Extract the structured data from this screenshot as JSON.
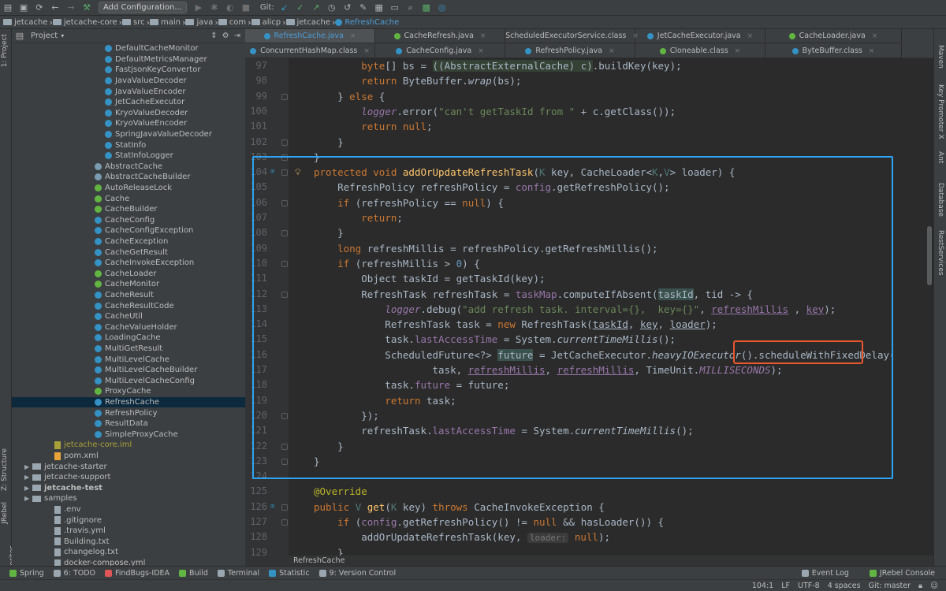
{
  "toolbar": {
    "breadcrumbs": [
      "jetcache",
      "jetcache-core",
      "src",
      "main",
      "java",
      "com",
      "alicp",
      "jetcache",
      "RefreshCache"
    ],
    "add_configuration": "Add Configuration...",
    "git_label": "Git:"
  },
  "left_stripe": {
    "project": "1: Project",
    "structure": "Z: Structure",
    "jrebel": "JRebel",
    "favorites": "2: Favorites"
  },
  "right_stripe": {
    "maven": "Maven",
    "key_promoter": "Key Promoter X",
    "ant": "Ant",
    "database": "Database",
    "rest_services": "RestServices"
  },
  "project_panel": {
    "title": "Project",
    "tree": [
      {
        "label": "DefaultCacheMonitor",
        "kind": "class",
        "indent": 1
      },
      {
        "label": "DefaultMetricsManager",
        "kind": "class",
        "indent": 1
      },
      {
        "label": "FastjsonKeyConvertor",
        "kind": "class",
        "indent": 1
      },
      {
        "label": "JavaValueDecoder",
        "kind": "class",
        "indent": 1
      },
      {
        "label": "JavaValueEncoder",
        "kind": "class",
        "indent": 1
      },
      {
        "label": "JetCacheExecutor",
        "kind": "class",
        "indent": 1
      },
      {
        "label": "KryoValueDecoder",
        "kind": "class",
        "indent": 1
      },
      {
        "label": "KryoValueEncoder",
        "kind": "class",
        "indent": 1
      },
      {
        "label": "SpringJavaValueDecoder",
        "kind": "class",
        "indent": 1
      },
      {
        "label": "StatInfo",
        "kind": "class",
        "indent": 1
      },
      {
        "label": "StatInfoLogger",
        "kind": "class",
        "indent": 1
      },
      {
        "label": "AbstractCache",
        "kind": "abstract",
        "indent": 0
      },
      {
        "label": "AbstractCacheBuilder",
        "kind": "abstract",
        "indent": 0
      },
      {
        "label": "AutoReleaseLock",
        "kind": "interface",
        "indent": 0
      },
      {
        "label": "Cache",
        "kind": "interface",
        "indent": 0
      },
      {
        "label": "CacheBuilder",
        "kind": "interface",
        "indent": 0
      },
      {
        "label": "CacheConfig",
        "kind": "class",
        "indent": 0
      },
      {
        "label": "CacheConfigException",
        "kind": "class",
        "indent": 0
      },
      {
        "label": "CacheException",
        "kind": "class",
        "indent": 0
      },
      {
        "label": "CacheGetResult",
        "kind": "class",
        "indent": 0
      },
      {
        "label": "CacheInvokeException",
        "kind": "class",
        "indent": 0
      },
      {
        "label": "CacheLoader",
        "kind": "interface",
        "indent": 0
      },
      {
        "label": "CacheMonitor",
        "kind": "interface",
        "indent": 0
      },
      {
        "label": "CacheResult",
        "kind": "class",
        "indent": 0
      },
      {
        "label": "CacheResultCode",
        "kind": "class",
        "indent": 0
      },
      {
        "label": "CacheUtil",
        "kind": "class",
        "indent": 0
      },
      {
        "label": "CacheValueHolder",
        "kind": "class",
        "indent": 0
      },
      {
        "label": "LoadingCache",
        "kind": "class",
        "indent": 0
      },
      {
        "label": "MultiGetResult",
        "kind": "class",
        "indent": 0
      },
      {
        "label": "MultiLevelCache",
        "kind": "class",
        "indent": 0
      },
      {
        "label": "MultiLevelCacheBuilder",
        "kind": "class",
        "indent": 0
      },
      {
        "label": "MultiLevelCacheConfig",
        "kind": "class",
        "indent": 0
      },
      {
        "label": "ProxyCache",
        "kind": "interface",
        "indent": 0
      },
      {
        "label": "RefreshCache",
        "kind": "class",
        "indent": 0,
        "selected": true
      },
      {
        "label": "RefreshPolicy",
        "kind": "class",
        "indent": 0
      },
      {
        "label": "ResultData",
        "kind": "class",
        "indent": 0
      },
      {
        "label": "SimpleProxyCache",
        "kind": "class",
        "indent": 0
      },
      {
        "label": "jetcache-core.iml",
        "kind": "iml",
        "indent": -2
      },
      {
        "label": "pom.xml",
        "kind": "xml",
        "indent": -2
      },
      {
        "label": "jetcache-starter",
        "kind": "folder",
        "indent": -3
      },
      {
        "label": "jetcache-support",
        "kind": "folder",
        "indent": -3
      },
      {
        "label": "jetcache-test",
        "kind": "folder-bold",
        "indent": -3
      },
      {
        "label": "samples",
        "kind": "folder",
        "indent": -3
      },
      {
        "label": ".env",
        "kind": "file",
        "indent": -4
      },
      {
        "label": ".gitignore",
        "kind": "file",
        "indent": -4
      },
      {
        "label": ".travis.yml",
        "kind": "file",
        "indent": -4
      },
      {
        "label": "Building.txt",
        "kind": "file",
        "indent": -4
      },
      {
        "label": "changelog.txt",
        "kind": "file",
        "indent": -4
      },
      {
        "label": "docker-compose.yml",
        "kind": "file",
        "indent": -4
      }
    ]
  },
  "tabs": {
    "row1": [
      {
        "label": "RefreshCache.java",
        "active": true,
        "icon": "class"
      },
      {
        "label": "CacheRefresh.java",
        "icon": "interface"
      },
      {
        "label": "ScheduledExecutorService.class",
        "icon": "interface"
      },
      {
        "label": "JetCacheExecutor.java",
        "icon": "class"
      },
      {
        "label": "CacheLoader.java",
        "icon": "interface"
      }
    ],
    "row2": [
      {
        "label": "ConcurrentHashMap.class",
        "icon": "class"
      },
      {
        "label": "CacheConfig.java",
        "icon": "class"
      },
      {
        "label": "RefreshPolicy.java",
        "icon": "class"
      },
      {
        "label": "Cloneable.class",
        "icon": "interface"
      },
      {
        "label": "ByteBuffer.class",
        "icon": "class"
      }
    ]
  },
  "editor": {
    "breadcrumb": "RefreshCache",
    "line_numbers": [
      "97",
      "98",
      "99",
      "100",
      "101",
      "102",
      "103",
      "104",
      "105",
      "106",
      "107",
      "108",
      "109",
      "110",
      "111",
      "112",
      "113",
      "114",
      "115",
      "116",
      "117",
      "118",
      "119",
      "120",
      "121",
      "122",
      "123",
      "124",
      "125",
      "126",
      "127",
      "128",
      "129"
    ]
  },
  "bottom_tools": {
    "left": [
      "Spring",
      "6: TODO",
      "FindBugs-IDEA",
      "Build",
      "Terminal",
      "Statistic",
      "9: Version Control"
    ],
    "right": [
      "Event Log",
      "JRebel Console"
    ]
  },
  "status": {
    "position": "104:1",
    "line_sep": "LF",
    "encoding": "UTF-8",
    "indent": "4 spaces",
    "branch": "Git: master"
  }
}
